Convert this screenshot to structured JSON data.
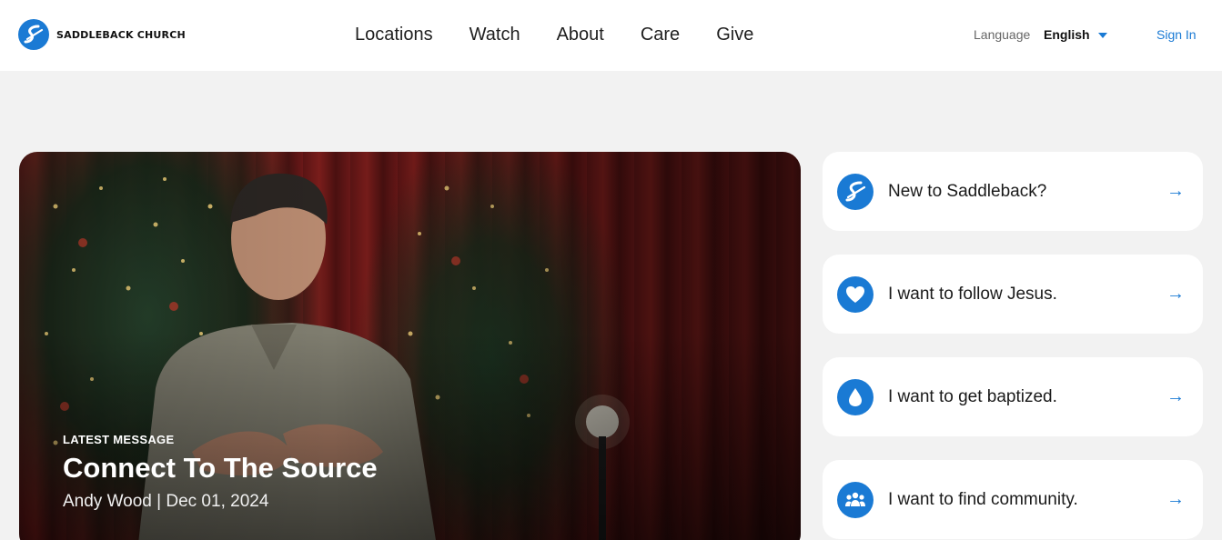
{
  "brand": {
    "name": "SADDLEBACK CHURCH",
    "accent": "#1a7ad4"
  },
  "nav": {
    "items": [
      "Locations",
      "Watch",
      "About",
      "Care",
      "Give"
    ]
  },
  "language": {
    "label": "Language",
    "value": "English"
  },
  "auth": {
    "signin_label": "Sign In"
  },
  "hero": {
    "kicker": "LATEST MESSAGE",
    "title": "Connect To The Source",
    "meta": "Andy Wood | Dec 01, 2024"
  },
  "cards": [
    {
      "label": "New to Saddleback?",
      "icon": "saddleback-logo-icon"
    },
    {
      "label": "I want to follow Jesus.",
      "icon": "heart-icon"
    },
    {
      "label": "I want to get baptized.",
      "icon": "water-drop-icon"
    },
    {
      "label": "I want to find community.",
      "icon": "community-icon"
    }
  ],
  "arrow_glyph": "→"
}
